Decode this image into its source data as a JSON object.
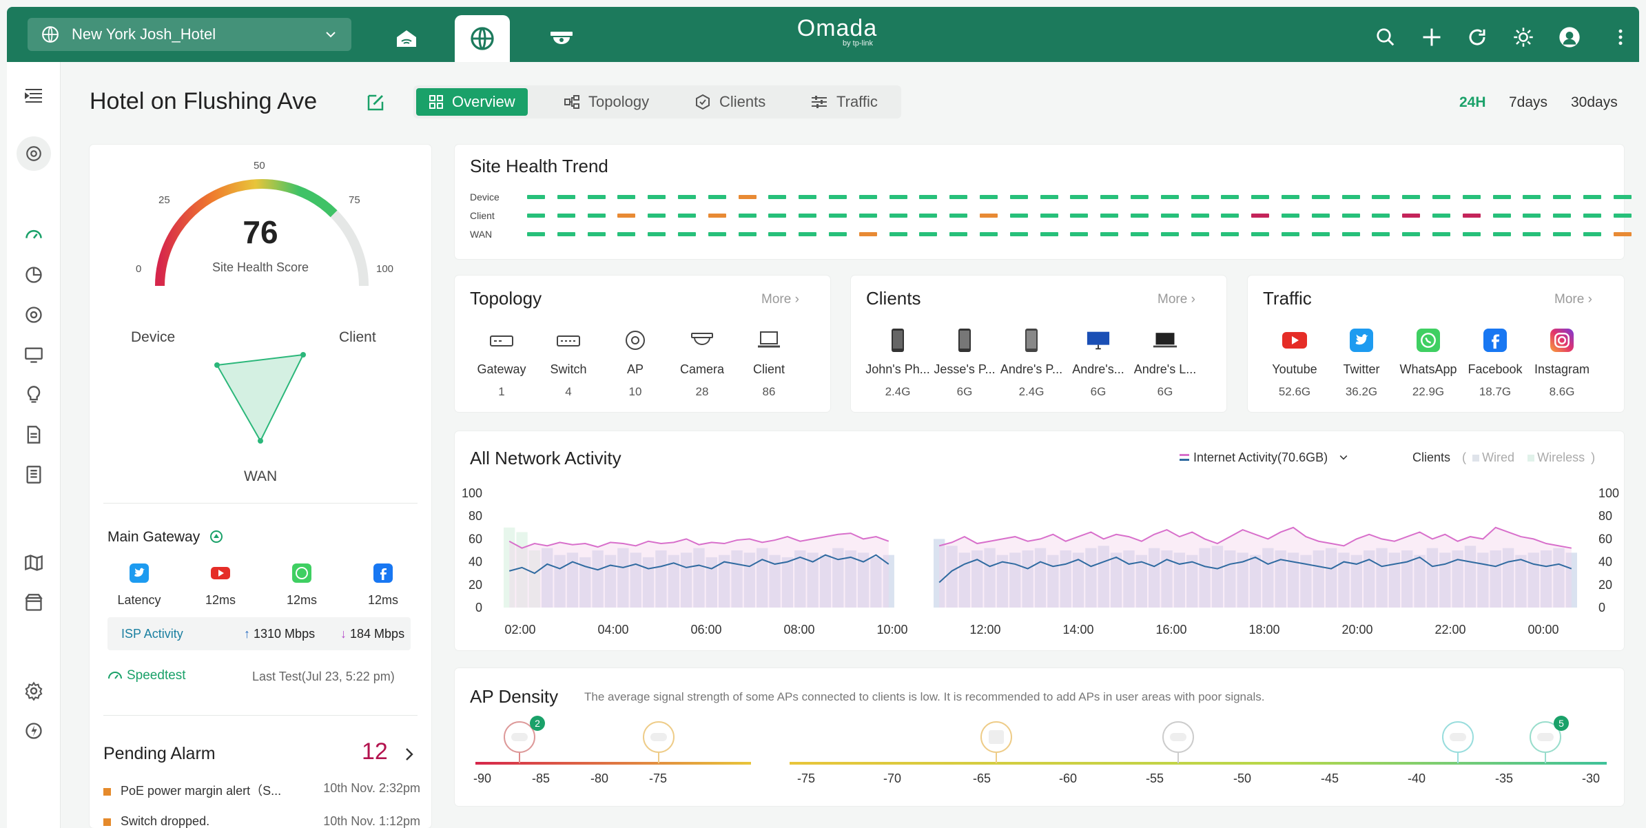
{
  "topbar": {
    "site_name": "New York Josh_Hotel",
    "logo": "Omada",
    "logo_sub": "by tp-link",
    "nav_icons": [
      "home-network-icon",
      "globe-icon",
      "camera-dome-icon"
    ],
    "right_icons": [
      "search-icon",
      "plus-icon",
      "refresh-icon",
      "sun-icon",
      "avatar",
      "more-vertical-icon"
    ]
  },
  "header": {
    "title": "Hotel on Flushing Ave",
    "tabs": [
      {
        "label": "Overview",
        "active": true
      },
      {
        "label": "Topology"
      },
      {
        "label": "Clients"
      },
      {
        "label": "Traffic"
      }
    ],
    "ranges": [
      {
        "label": "24H",
        "active": true
      },
      {
        "label": "7days"
      },
      {
        "label": "30days"
      }
    ]
  },
  "health_score": {
    "score": "76",
    "label": "Site Health Score",
    "ticks": [
      "0",
      "25",
      "50",
      "75",
      "100"
    ],
    "radar_labels": {
      "device": "Device",
      "client": "Client",
      "wan": "WAN"
    }
  },
  "main_gateway": {
    "title": "Main Gateway",
    "items": [
      {
        "icon": "twitter-icon",
        "label": "Latency"
      },
      {
        "icon": "youtube-icon",
        "label": "12ms"
      },
      {
        "icon": "whatsapp-icon",
        "label": "12ms"
      },
      {
        "icon": "facebook-icon",
        "label": "12ms"
      }
    ],
    "isp_label": "ISP Activity",
    "upload": "1310 Mbps",
    "download": "184 Mbps",
    "speedtest_label": "Speedtest",
    "last_test": "Last Test(Jul 23, 5:22 pm)"
  },
  "pending_alarm": {
    "title": "Pending Alarm",
    "count": "12",
    "items": [
      {
        "text": "PoE power margin alert（S...",
        "time": "10th Nov. 2:32pm"
      },
      {
        "text": "Switch dropped.",
        "time": "10th Nov. 1:12pm"
      }
    ]
  },
  "site_health_trend": {
    "title": "Site Health Trend",
    "rows": [
      {
        "label": "Device",
        "status": [
          "g",
          "g",
          "g",
          "g",
          "g",
          "g",
          "g",
          "o",
          "g",
          "g",
          "g",
          "g",
          "g",
          "g",
          "g",
          "g",
          "g",
          "g",
          "g",
          "g",
          "g",
          "g",
          "g",
          "g",
          "g",
          "g",
          "g",
          "g",
          "g",
          "g",
          "g",
          "g",
          "g",
          "g",
          "g",
          "g",
          "g"
        ]
      },
      {
        "label": "Client",
        "status": [
          "g",
          "g",
          "g",
          "o",
          "g",
          "g",
          "o",
          "g",
          "g",
          "g",
          "g",
          "g",
          "g",
          "g",
          "g",
          "o",
          "g",
          "g",
          "g",
          "g",
          "g",
          "g",
          "g",
          "g",
          "r",
          "g",
          "g",
          "g",
          "g",
          "r",
          "g",
          "r",
          "g",
          "g",
          "g",
          "g",
          "g"
        ]
      },
      {
        "label": "WAN",
        "status": [
          "g",
          "g",
          "g",
          "g",
          "g",
          "g",
          "g",
          "g",
          "g",
          "g",
          "g",
          "o",
          "g",
          "g",
          "g",
          "g",
          "g",
          "g",
          "g",
          "g",
          "g",
          "g",
          "g",
          "g",
          "g",
          "g",
          "g",
          "g",
          "g",
          "g",
          "g",
          "g",
          "g",
          "g",
          "g",
          "g",
          "o"
        ]
      }
    ],
    "colors": {
      "g": "#27c07a",
      "o": "#e88a34",
      "r": "#c4245a"
    }
  },
  "topology": {
    "title": "Topology",
    "more": "More",
    "items": [
      {
        "icon": "gateway-icon",
        "label": "Gateway",
        "value": "1"
      },
      {
        "icon": "switch-icon",
        "label": "Switch",
        "value": "4"
      },
      {
        "icon": "ap-icon",
        "label": "AP",
        "value": "10"
      },
      {
        "icon": "camera-icon",
        "label": "Camera",
        "value": "28"
      },
      {
        "icon": "client-icon",
        "label": "Client",
        "value": "86"
      }
    ]
  },
  "clients": {
    "title": "Clients",
    "more": "More",
    "items": [
      {
        "icon": "phone-icon",
        "label": "John's Ph...",
        "value": "2.4G"
      },
      {
        "icon": "phone-icon",
        "label": "Jesse's P...",
        "value": "6G"
      },
      {
        "icon": "phone-icon",
        "label": "Andre's P...",
        "value": "2.4G"
      },
      {
        "icon": "monitor-icon",
        "label": "Andre's...",
        "value": "6G"
      },
      {
        "icon": "laptop-icon",
        "label": "Andre's L...",
        "value": "6G"
      }
    ]
  },
  "traffic": {
    "title": "Traffic",
    "more": "More",
    "items": [
      {
        "icon": "youtube-icon",
        "label": "Youtube",
        "value": "52.6G"
      },
      {
        "icon": "twitter-icon",
        "label": "Twitter",
        "value": "36.2G"
      },
      {
        "icon": "whatsapp-icon",
        "label": "WhatsApp",
        "value": "22.9G"
      },
      {
        "icon": "facebook-icon",
        "label": "Facebook",
        "value": "18.7G"
      },
      {
        "icon": "instagram-icon",
        "label": "Instagram",
        "value": "8.6G"
      }
    ]
  },
  "network_activity": {
    "title": "All Network Activity",
    "internet_label": "Internet Activity(70.6GB)",
    "clients_label": "Clients",
    "paren_open": "(",
    "paren_close": ")",
    "wired": "Wired",
    "wireless": "Wireless"
  },
  "chart_data": {
    "type": "line",
    "x": [
      "02:00",
      "04:00",
      "06:00",
      "08:00",
      "10:00",
      "12:00",
      "14:00",
      "16:00",
      "18:00",
      "20:00",
      "22:00",
      "00:00"
    ],
    "ylim": [
      0,
      100
    ],
    "yticks": [
      "100",
      "80",
      "60",
      "40",
      "20",
      "0"
    ],
    "series": [
      {
        "color": "#d86fcb",
        "values": [
          58,
          52,
          56,
          54,
          57,
          55,
          56,
          53,
          57,
          56,
          54,
          58,
          56,
          57,
          60,
          55,
          57,
          56,
          59,
          60,
          57,
          59,
          62,
          58,
          60,
          62,
          64,
          65,
          60,
          62,
          58,
          null,
          null,
          null,
          54,
          57,
          62,
          56,
          58,
          60,
          62,
          58,
          60,
          64,
          58,
          62,
          66,
          60,
          64,
          62,
          58,
          64,
          68,
          62,
          66,
          60,
          56,
          62,
          68,
          64,
          60,
          66,
          70,
          62,
          58,
          56,
          54,
          60,
          64,
          60,
          58,
          62,
          66,
          60,
          64,
          58,
          62,
          60,
          70,
          66,
          62,
          60,
          56,
          54,
          52
        ]
      },
      {
        "color": "#2f6aa0",
        "values": [
          32,
          35,
          30,
          38,
          34,
          40,
          36,
          33,
          37,
          35,
          38,
          34,
          36,
          39,
          35,
          37,
          34,
          40,
          38,
          36,
          42,
          38,
          40,
          44,
          40,
          46,
          42,
          44,
          40,
          46,
          38,
          null,
          null,
          null,
          22,
          32,
          38,
          42,
          36,
          40,
          38,
          34,
          40,
          36,
          38,
          42,
          36,
          40,
          44,
          38,
          40,
          36,
          42,
          38,
          40,
          36,
          34,
          38,
          40,
          44,
          38,
          42,
          40,
          38,
          36,
          34,
          40,
          38,
          42,
          36,
          38,
          40,
          44,
          36,
          38,
          42,
          40,
          38,
          36,
          40,
          42,
          38,
          36,
          38,
          34
        ]
      },
      {
        "color": "#bccbe3",
        "values": [
          70,
          66,
          50,
          52,
          46,
          48,
          44,
          50,
          46,
          52,
          48,
          44,
          50,
          46,
          48,
          52,
          44,
          46,
          50,
          48,
          52,
          46,
          44,
          50,
          48,
          46,
          52,
          50,
          48,
          44,
          46,
          null,
          null,
          null,
          60,
          54,
          48,
          50,
          52,
          46,
          48,
          50,
          52,
          46,
          50,
          48,
          52,
          54,
          48,
          50,
          46,
          52,
          50,
          48,
          46,
          52,
          54,
          50,
          48,
          46,
          52,
          50,
          48,
          46,
          50,
          52,
          48,
          46,
          50,
          52,
          48,
          50,
          46,
          52,
          48,
          50,
          54,
          48,
          50,
          52,
          46,
          48,
          50,
          52,
          48
        ]
      }
    ]
  },
  "ap_density": {
    "title": "AP Density",
    "description": "The average signal strength of some APs connected to clients is low. It is recommended to add APs in user areas with poor signals.",
    "axis": [
      "-90",
      "-85",
      "-80",
      "-75",
      "-75",
      "-70",
      "-65",
      "-60",
      "-55",
      "-50",
      "-45",
      "-40",
      "-35",
      "-30"
    ],
    "badges": [
      "2",
      "5"
    ]
  }
}
